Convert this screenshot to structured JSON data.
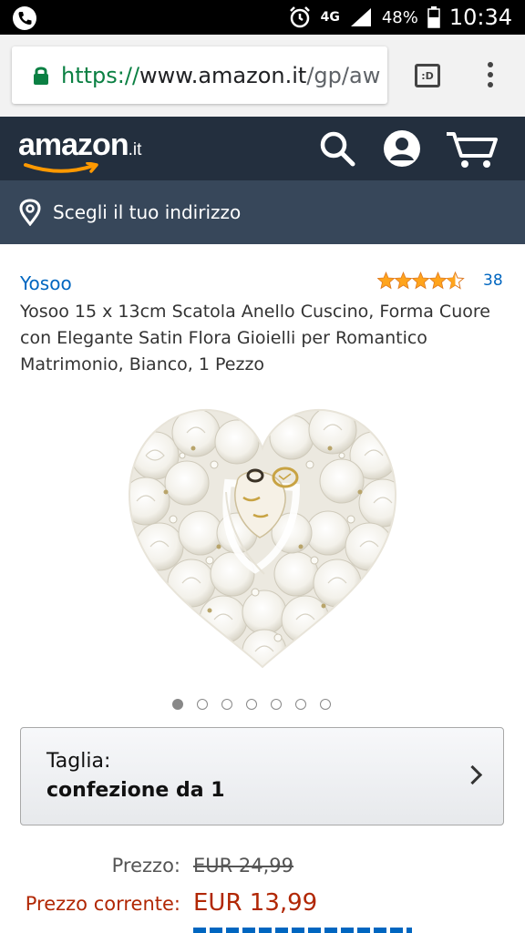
{
  "status_bar": {
    "network": "4G",
    "battery": "48%",
    "time": "10:34"
  },
  "browser": {
    "url_scheme": "https://",
    "url_host": "www.amazon.it",
    "url_path": "/gp/aw",
    "tabs_label": ":D"
  },
  "header": {
    "logo_text": "amazon",
    "logo_tld": ".it"
  },
  "address_bar": {
    "label": "Scegli il tuo indirizzo"
  },
  "product": {
    "brand": "Yosoo",
    "rating": 4.5,
    "review_count": "38",
    "title": "Yosoo 15 x 13cm Scatola Anello Cuscino, Forma Cuore con Elegante Satin Flora Gioielli per Romantico Matrimonio, Bianco, 1 Pezzo",
    "image_count": 7,
    "active_image": 1
  },
  "size_selector": {
    "label": "Taglia:",
    "value": "confezione da 1"
  },
  "pricing": {
    "list_label": "Prezzo:",
    "list_price": "EUR 24,99",
    "current_label": "Prezzo corrente:",
    "current_price": "EUR 13,99"
  },
  "colors": {
    "amazon_header": "#232f3e",
    "address_bar": "#37475a",
    "link": "#0066c0",
    "price": "#b12704",
    "star": "#ffa41c",
    "chrome_lock": "#0b8043"
  }
}
